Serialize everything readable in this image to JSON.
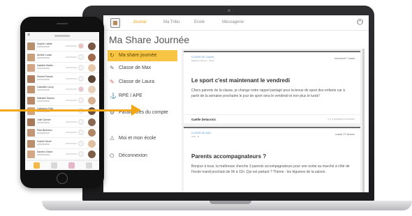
{
  "laptop": {
    "nav": {
      "tabs": [
        "Journal",
        "Ma Tribu",
        "Ecole",
        "Messagerie"
      ],
      "active_tab": "Journal"
    },
    "page_title": "Ma Share Journée",
    "sidebar": {
      "items": [
        {
          "label": "Ma share journée",
          "icon": "share-icon"
        },
        {
          "label": "Classe de Max",
          "icon": "class-icon"
        },
        {
          "label": "Classe de Laura",
          "icon": "class-icon"
        },
        {
          "label": "RPE / APE",
          "icon": "anchor-icon"
        },
        {
          "label": "Paramètres du compte",
          "icon": "gear-icon"
        },
        {
          "label": "Moi et mon école",
          "icon": "warning-icon"
        },
        {
          "label": "Déconnexion",
          "icon": "power-icon"
        }
      ]
    },
    "posts": [
      {
        "meta": "Classe de Laura",
        "meta2": "Magenta Samion · Steve",
        "date": "mercredi 7 mars",
        "title": "Le sport c'est maintenant le vendredi",
        "body": "Chers parents de la classe, je change notre rappel partagé pour la tenue de sport des enfants car à partir de la semaine prochaine le jour de sport sera le vendredi et non plus le lundi !",
        "author": "Gaëlle Delacroix",
        "ago": "Il y a quelques secondes"
      },
      {
        "meta": "Classe de Max",
        "meta2": "CM1 · B",
        "date": "mardi 27 février",
        "title": "Parents accompagnateurs ?",
        "body": "Bonjour à tous, la maîtresse cherche 3 parents accompagnateurs pour une sortie au marché à côté de l'école mardi prochain de 9h à 11h. Qui est partant ? Thème : les légumes de la saison."
      }
    ]
  },
  "phone": {
    "children": [
      {
        "name": "Sophie Labbe",
        "photo": "#b8906e",
        "avatar": "#7a5a44",
        "badge": "#f0c0c0"
      },
      {
        "name": "Amélie Lucas",
        "photo": "#c9a07c",
        "avatar": "#a06a4c",
        "badge": "#f5f5f5"
      },
      {
        "name": "Isabelle Martin",
        "photo": "#d1a585",
        "avatar": "#e9c9a9",
        "badge": "#f5f5f5"
      },
      {
        "name": "Rachel Pascal",
        "photo": "#ad7f60",
        "avatar": "#5d4535",
        "badge": "#f5f5f5"
      },
      {
        "name": "Gabrielle Leroy",
        "photo": "#c39472",
        "avatar": "#e8d0b8",
        "badge": "#f0c4d0"
      },
      {
        "name": "Nathalie Dubois",
        "photo": "#b78a69",
        "avatar": "#d8b090",
        "badge": "#f5f5f5"
      },
      {
        "name": "Catherine Petit",
        "photo": "#cfa47f",
        "avatar": "#6e5040",
        "badge": "#f5f5f5"
      },
      {
        "name": "Julie Garnier",
        "photo": "#a8785a",
        "avatar": "#8b6a55",
        "badge": "#f5f5f5"
      },
      {
        "name": "Paul Bertrand",
        "photo": "#c29777",
        "avatar": "#b08868",
        "badge": "#f5f5f5"
      },
      {
        "name": "Sophie Morel",
        "photo": "#b98e6c",
        "avatar": "#e0c0a0",
        "badge": "#f5f5f5"
      },
      {
        "name": "Sandra Girard",
        "photo": "#d2a888",
        "avatar": "#7d5c48",
        "badge": "#f5f5f5"
      }
    ],
    "tabs": [
      {
        "name": "home-tab-icon",
        "color": "#f4b94a"
      },
      {
        "name": "tribe-tab-icon",
        "color": "#d9d9d9"
      },
      {
        "name": "school-tab-icon",
        "color": "#e5b6c8"
      },
      {
        "name": "messages-tab-icon",
        "color": "#d9d9d9"
      }
    ]
  },
  "colors": {
    "accent": "#f4a316",
    "active_sidebar": "#f8c443",
    "link_blue": "#5b9bd5",
    "arrow": "#f3a716"
  }
}
